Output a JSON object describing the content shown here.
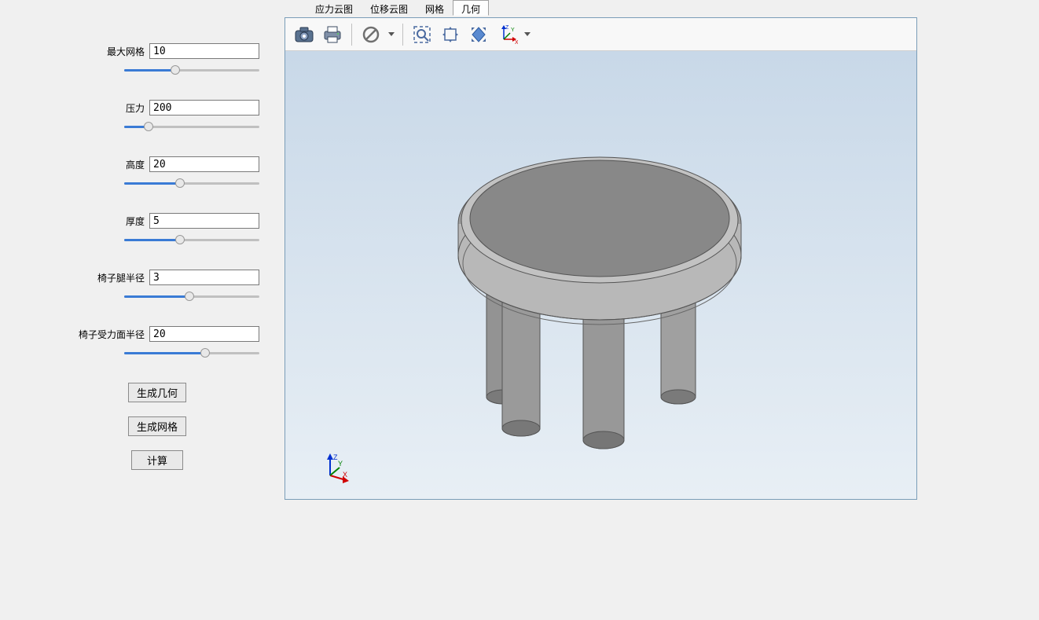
{
  "params": {
    "max_mesh": {
      "label": "最大网格",
      "value": "10",
      "slider_pct": 38
    },
    "pressure": {
      "label": "压力",
      "value": "200",
      "slider_pct": 18
    },
    "height": {
      "label": "高度",
      "value": "20",
      "slider_pct": 41
    },
    "thickness": {
      "label": "厚度",
      "value": "5",
      "slider_pct": 41
    },
    "leg_radius": {
      "label": "椅子腿半径",
      "value": "3",
      "slider_pct": 48
    },
    "force_radius": {
      "label": "椅子受力面半径",
      "value": "20",
      "slider_pct": 60
    }
  },
  "buttons": {
    "gen_geometry": "生成几何",
    "gen_mesh": "生成网格",
    "compute": "计算"
  },
  "tabs": {
    "stress_cloud": "应力云图",
    "disp_cloud": "位移云图",
    "mesh": "网格",
    "geometry": "几何"
  },
  "active_tab": "geometry",
  "axis_labels": {
    "x": "X",
    "y": "Y",
    "z": "Z"
  }
}
